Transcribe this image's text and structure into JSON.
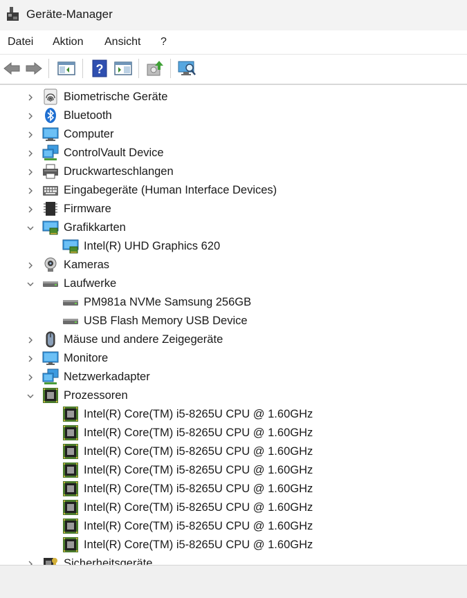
{
  "window": {
    "title": "Geräte-Manager"
  },
  "menu": {
    "items": [
      "Datei",
      "Aktion",
      "Ansicht",
      "?"
    ]
  },
  "toolbar": {
    "buttons": [
      "back-arrow-icon",
      "forward-arrow-icon",
      "show-hide-console-tree-icon",
      "help-icon",
      "properties-icon",
      "update-driver-icon",
      "scan-hardware-icon"
    ]
  },
  "tree": {
    "items": [
      {
        "label": "Biometrische Geräte",
        "icon": "fingerprint-icon",
        "level": 0,
        "expanded": false
      },
      {
        "label": "Bluetooth",
        "icon": "bluetooth-icon",
        "level": 0,
        "expanded": false
      },
      {
        "label": "Computer",
        "icon": "computer-icon",
        "level": 0,
        "expanded": false
      },
      {
        "label": "ControlVault Device",
        "icon": "network-icon",
        "level": 0,
        "expanded": false
      },
      {
        "label": "Druckwarteschlangen",
        "icon": "printer-icon",
        "level": 0,
        "expanded": false
      },
      {
        "label": "Eingabegeräte (Human Interface Devices)",
        "icon": "keyboard-icon",
        "level": 0,
        "expanded": false
      },
      {
        "label": "Firmware",
        "icon": "chip-icon",
        "level": 0,
        "expanded": false
      },
      {
        "label": "Grafikkarten",
        "icon": "display-adapter-icon",
        "level": 0,
        "expanded": true
      },
      {
        "label": "Intel(R) UHD Graphics 620",
        "icon": "display-adapter-icon",
        "level": 1
      },
      {
        "label": "Kameras",
        "icon": "webcam-icon",
        "level": 0,
        "expanded": false
      },
      {
        "label": "Laufwerke",
        "icon": "drive-icon",
        "level": 0,
        "expanded": true
      },
      {
        "label": "PM981a NVMe Samsung 256GB",
        "icon": "drive-icon",
        "level": 1
      },
      {
        "label": "USB Flash Memory USB Device",
        "icon": "drive-icon",
        "level": 1
      },
      {
        "label": "Mäuse und andere Zeigegeräte",
        "icon": "mouse-icon",
        "level": 0,
        "expanded": false
      },
      {
        "label": "Monitore",
        "icon": "monitor-icon",
        "level": 0,
        "expanded": false
      },
      {
        "label": "Netzwerkadapter",
        "icon": "network-icon",
        "level": 0,
        "expanded": false
      },
      {
        "label": "Prozessoren",
        "icon": "processor-icon",
        "level": 0,
        "expanded": true
      },
      {
        "label": "Intel(R) Core(TM) i5-8265U CPU @ 1.60GHz",
        "icon": "processor-icon",
        "level": 1
      },
      {
        "label": "Intel(R) Core(TM) i5-8265U CPU @ 1.60GHz",
        "icon": "processor-icon",
        "level": 1
      },
      {
        "label": "Intel(R) Core(TM) i5-8265U CPU @ 1.60GHz",
        "icon": "processor-icon",
        "level": 1
      },
      {
        "label": "Intel(R) Core(TM) i5-8265U CPU @ 1.60GHz",
        "icon": "processor-icon",
        "level": 1
      },
      {
        "label": "Intel(R) Core(TM) i5-8265U CPU @ 1.60GHz",
        "icon": "processor-icon",
        "level": 1
      },
      {
        "label": "Intel(R) Core(TM) i5-8265U CPU @ 1.60GHz",
        "icon": "processor-icon",
        "level": 1
      },
      {
        "label": "Intel(R) Core(TM) i5-8265U CPU @ 1.60GHz",
        "icon": "processor-icon",
        "level": 1
      },
      {
        "label": "Intel(R) Core(TM) i5-8265U CPU @ 1.60GHz",
        "icon": "processor-icon",
        "level": 1
      },
      {
        "label": "Sicherheitsgeräte",
        "icon": "security-device-icon",
        "level": 0,
        "expanded": false
      }
    ]
  },
  "colors": {
    "titlebar": "#f3f3f3",
    "accent": "#0067c0",
    "chip_green": "#4a7a2c"
  }
}
